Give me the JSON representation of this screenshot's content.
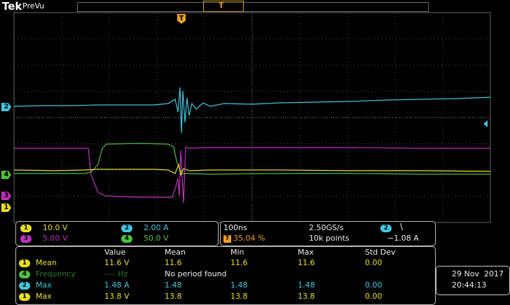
{
  "header": {
    "logo": "Tek",
    "mode": "PreVu",
    "trigger_marker": "T"
  },
  "colors": {
    "ch1": "#e8e020",
    "ch2": "#40c8e0",
    "ch3": "#c030c0",
    "ch4": "#50c040",
    "trigger": "#f0a020"
  },
  "markers": {
    "ch1": "1",
    "ch2": "2",
    "ch3": "3",
    "ch4": "4"
  },
  "channel_panel": {
    "ch1": {
      "badge": "1",
      "value": "10.0 V"
    },
    "ch2": {
      "badge": "2",
      "value": "2.00 A"
    },
    "ch3": {
      "badge": "3",
      "value": "5.00 V"
    },
    "ch4": {
      "badge": "4",
      "value": "50.0 V"
    }
  },
  "timebase_panel": {
    "scale": "100ns",
    "sample_rate": "2.50GS/s",
    "trigger_badge": "T",
    "trigger_pos": "35.04 %",
    "record_length": "10k points",
    "trigger_channel": "2",
    "trigger_slope": "\\",
    "trigger_level": "−1.08 A"
  },
  "measurements": {
    "headers": {
      "value": "Value",
      "mean": "Mean",
      "min": "Min",
      "max": "Max",
      "std": "Std Dev"
    },
    "rows": [
      {
        "badge": "1",
        "label": "Mean",
        "value": "11.6 V",
        "mean": "11.6",
        "min": "11.6",
        "max": "11.6",
        "std": "0.00"
      },
      {
        "badge": "4",
        "label": "Frequency",
        "value": "---- Hz",
        "note": "No period found"
      },
      {
        "badge": "2",
        "label": "Max",
        "value": "1.48 A",
        "mean": "1.48",
        "min": "1.48",
        "max": "1.48",
        "std": "0.00"
      },
      {
        "badge": "1",
        "label": "Max",
        "value": "13.8 V",
        "mean": "13.8",
        "min": "13.8",
        "max": "13.8",
        "std": "0.00"
      }
    ]
  },
  "datetime": {
    "date": "29 Nov  2017",
    "time": "20:44:13"
  }
}
